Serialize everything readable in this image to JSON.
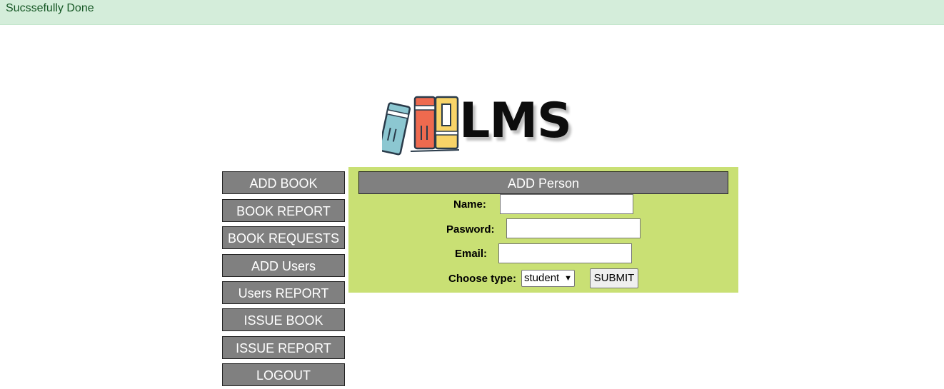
{
  "alert": {
    "message": "Sucssefully Done"
  },
  "logo": {
    "text": "LMS"
  },
  "menu": {
    "items": [
      {
        "label": "ADD BOOK"
      },
      {
        "label": "BOOK REPORT"
      },
      {
        "label": "BOOK REQUESTS"
      },
      {
        "label": "ADD Users"
      },
      {
        "label": "Users REPORT"
      },
      {
        "label": "ISSUE BOOK"
      },
      {
        "label": "ISSUE REPORT"
      },
      {
        "label": "LOGOUT"
      }
    ]
  },
  "form": {
    "title": "ADD Person",
    "name_label": "Name:",
    "name_value": "",
    "password_label": "Pasword:",
    "password_value": "",
    "email_label": "Email:",
    "email_value": "",
    "type_label": "Choose type:",
    "type_selected": "student",
    "submit_label": "SUBMIT"
  },
  "colors": {
    "alert_bg": "#d4edda",
    "alert_text": "#155724",
    "panel_bg": "#c9e074",
    "button_bg": "#808080"
  },
  "icons": {
    "logo": "books-logo-icon",
    "select_caret": "chevron-down-icon"
  }
}
